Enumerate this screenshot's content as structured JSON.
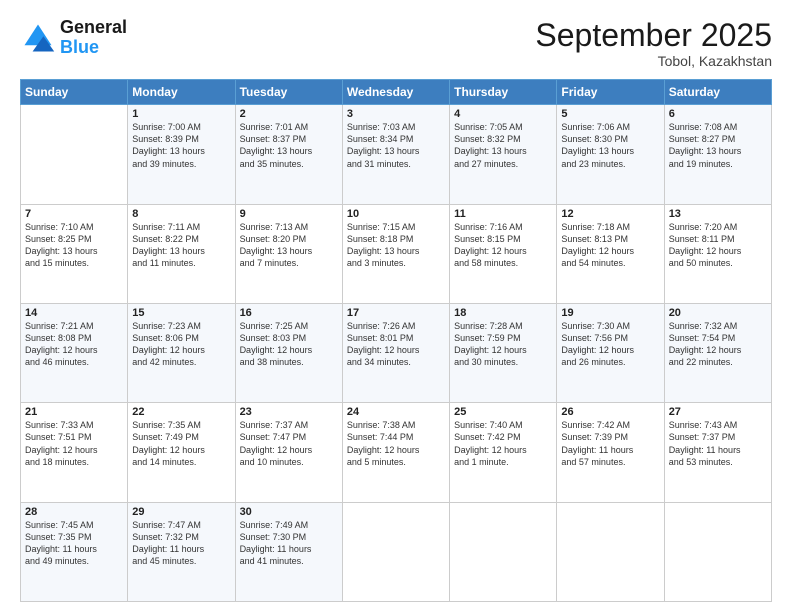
{
  "header": {
    "logo_line1": "General",
    "logo_line2": "Blue",
    "month": "September 2025",
    "location": "Tobol, Kazakhstan"
  },
  "weekdays": [
    "Sunday",
    "Monday",
    "Tuesday",
    "Wednesday",
    "Thursday",
    "Friday",
    "Saturday"
  ],
  "weeks": [
    [
      {
        "day": "",
        "info": ""
      },
      {
        "day": "1",
        "info": "Sunrise: 7:00 AM\nSunset: 8:39 PM\nDaylight: 13 hours\nand 39 minutes."
      },
      {
        "day": "2",
        "info": "Sunrise: 7:01 AM\nSunset: 8:37 PM\nDaylight: 13 hours\nand 35 minutes."
      },
      {
        "day": "3",
        "info": "Sunrise: 7:03 AM\nSunset: 8:34 PM\nDaylight: 13 hours\nand 31 minutes."
      },
      {
        "day": "4",
        "info": "Sunrise: 7:05 AM\nSunset: 8:32 PM\nDaylight: 13 hours\nand 27 minutes."
      },
      {
        "day": "5",
        "info": "Sunrise: 7:06 AM\nSunset: 8:30 PM\nDaylight: 13 hours\nand 23 minutes."
      },
      {
        "day": "6",
        "info": "Sunrise: 7:08 AM\nSunset: 8:27 PM\nDaylight: 13 hours\nand 19 minutes."
      }
    ],
    [
      {
        "day": "7",
        "info": "Sunrise: 7:10 AM\nSunset: 8:25 PM\nDaylight: 13 hours\nand 15 minutes."
      },
      {
        "day": "8",
        "info": "Sunrise: 7:11 AM\nSunset: 8:22 PM\nDaylight: 13 hours\nand 11 minutes."
      },
      {
        "day": "9",
        "info": "Sunrise: 7:13 AM\nSunset: 8:20 PM\nDaylight: 13 hours\nand 7 minutes."
      },
      {
        "day": "10",
        "info": "Sunrise: 7:15 AM\nSunset: 8:18 PM\nDaylight: 13 hours\nand 3 minutes."
      },
      {
        "day": "11",
        "info": "Sunrise: 7:16 AM\nSunset: 8:15 PM\nDaylight: 12 hours\nand 58 minutes."
      },
      {
        "day": "12",
        "info": "Sunrise: 7:18 AM\nSunset: 8:13 PM\nDaylight: 12 hours\nand 54 minutes."
      },
      {
        "day": "13",
        "info": "Sunrise: 7:20 AM\nSunset: 8:11 PM\nDaylight: 12 hours\nand 50 minutes."
      }
    ],
    [
      {
        "day": "14",
        "info": "Sunrise: 7:21 AM\nSunset: 8:08 PM\nDaylight: 12 hours\nand 46 minutes."
      },
      {
        "day": "15",
        "info": "Sunrise: 7:23 AM\nSunset: 8:06 PM\nDaylight: 12 hours\nand 42 minutes."
      },
      {
        "day": "16",
        "info": "Sunrise: 7:25 AM\nSunset: 8:03 PM\nDaylight: 12 hours\nand 38 minutes."
      },
      {
        "day": "17",
        "info": "Sunrise: 7:26 AM\nSunset: 8:01 PM\nDaylight: 12 hours\nand 34 minutes."
      },
      {
        "day": "18",
        "info": "Sunrise: 7:28 AM\nSunset: 7:59 PM\nDaylight: 12 hours\nand 30 minutes."
      },
      {
        "day": "19",
        "info": "Sunrise: 7:30 AM\nSunset: 7:56 PM\nDaylight: 12 hours\nand 26 minutes."
      },
      {
        "day": "20",
        "info": "Sunrise: 7:32 AM\nSunset: 7:54 PM\nDaylight: 12 hours\nand 22 minutes."
      }
    ],
    [
      {
        "day": "21",
        "info": "Sunrise: 7:33 AM\nSunset: 7:51 PM\nDaylight: 12 hours\nand 18 minutes."
      },
      {
        "day": "22",
        "info": "Sunrise: 7:35 AM\nSunset: 7:49 PM\nDaylight: 12 hours\nand 14 minutes."
      },
      {
        "day": "23",
        "info": "Sunrise: 7:37 AM\nSunset: 7:47 PM\nDaylight: 12 hours\nand 10 minutes."
      },
      {
        "day": "24",
        "info": "Sunrise: 7:38 AM\nSunset: 7:44 PM\nDaylight: 12 hours\nand 5 minutes."
      },
      {
        "day": "25",
        "info": "Sunrise: 7:40 AM\nSunset: 7:42 PM\nDaylight: 12 hours\nand 1 minute."
      },
      {
        "day": "26",
        "info": "Sunrise: 7:42 AM\nSunset: 7:39 PM\nDaylight: 11 hours\nand 57 minutes."
      },
      {
        "day": "27",
        "info": "Sunrise: 7:43 AM\nSunset: 7:37 PM\nDaylight: 11 hours\nand 53 minutes."
      }
    ],
    [
      {
        "day": "28",
        "info": "Sunrise: 7:45 AM\nSunset: 7:35 PM\nDaylight: 11 hours\nand 49 minutes."
      },
      {
        "day": "29",
        "info": "Sunrise: 7:47 AM\nSunset: 7:32 PM\nDaylight: 11 hours\nand 45 minutes."
      },
      {
        "day": "30",
        "info": "Sunrise: 7:49 AM\nSunset: 7:30 PM\nDaylight: 11 hours\nand 41 minutes."
      },
      {
        "day": "",
        "info": ""
      },
      {
        "day": "",
        "info": ""
      },
      {
        "day": "",
        "info": ""
      },
      {
        "day": "",
        "info": ""
      }
    ]
  ]
}
